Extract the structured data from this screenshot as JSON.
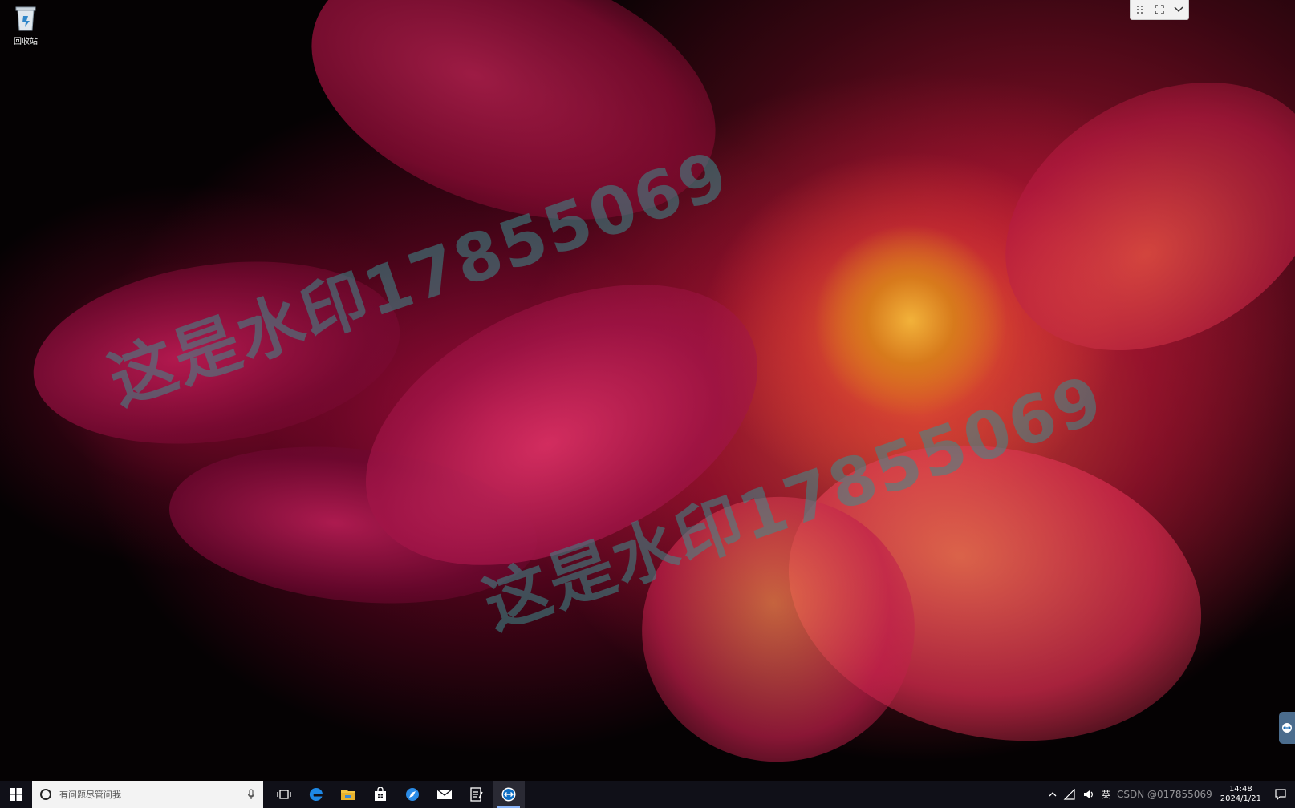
{
  "desktop": {
    "icons": [
      {
        "label": "回收站",
        "icon": "recycle-bin-icon"
      }
    ],
    "watermark_text": "这是水印17855069"
  },
  "remote_toolbar": {
    "icons": [
      "drag-handle-icon",
      "fullscreen-icon",
      "chevron-down-icon"
    ]
  },
  "taskbar": {
    "search_placeholder": "有问题尽管问我",
    "pinned": [
      "task-view-icon",
      "edge-icon",
      "file-explorer-icon",
      "store-icon",
      "browser-icon",
      "mail-icon",
      "notepad-icon",
      "teamviewer-icon"
    ],
    "tray": {
      "ime": "英",
      "time": "14:48",
      "date": "2024/1/21"
    },
    "overlay_text": "CSDN @017855069"
  },
  "colors": {
    "taskbar_bg": "#101018",
    "accent": "#0078d7"
  }
}
